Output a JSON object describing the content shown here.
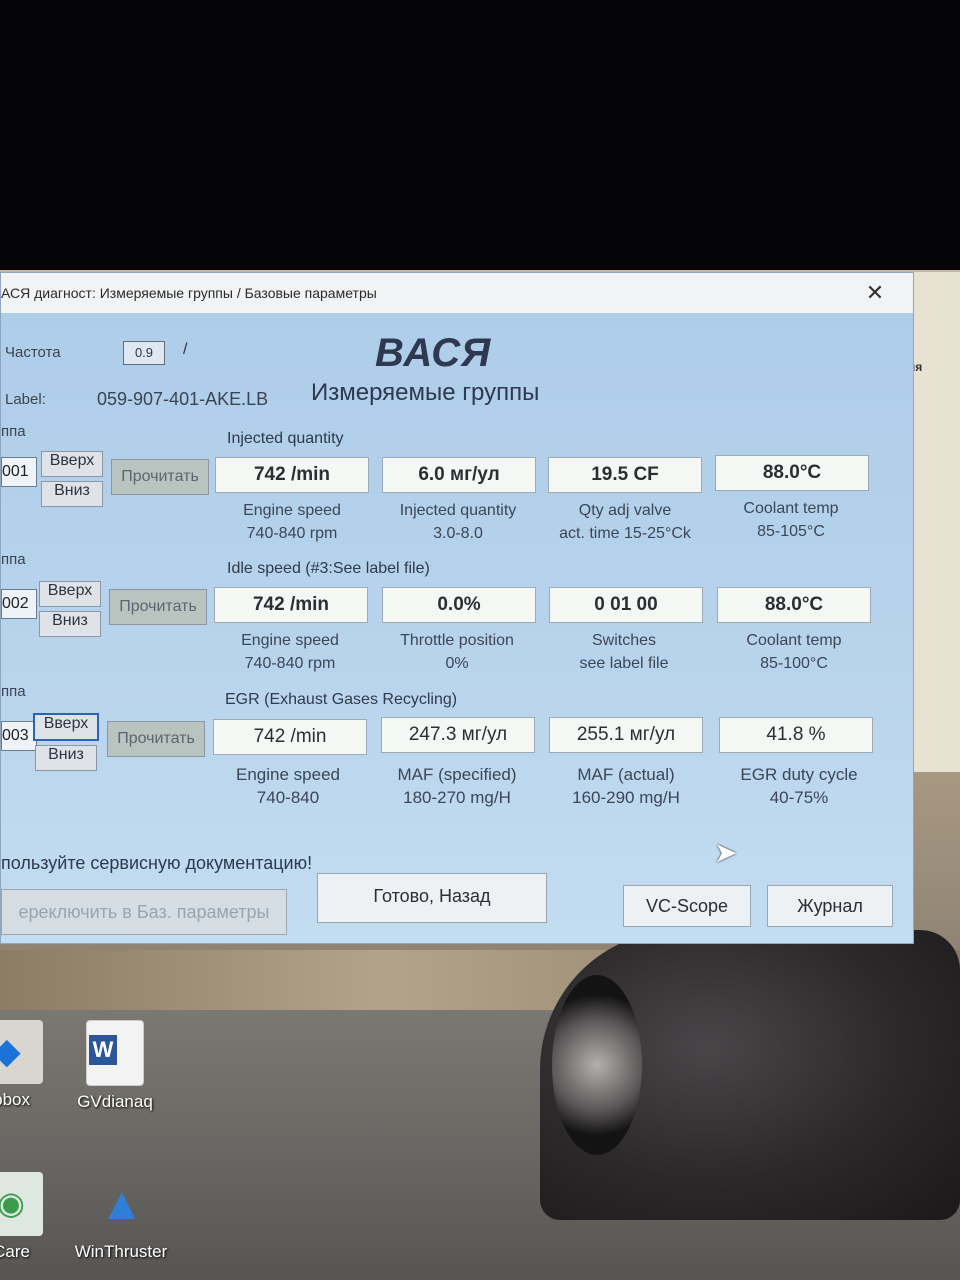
{
  "window": {
    "title": "АСЯ диагност: Измеряемые группы / Базовые параметры",
    "close_glyph": "✕"
  },
  "header": {
    "freq_label": "Частота",
    "freq_value": "0.9",
    "freq_spin": "/",
    "label_label": "Label:",
    "label_file": "059-907-401-AKE.LB",
    "logo": "ВАСЯ",
    "subtitle": "Измеряемые группы"
  },
  "groups": [
    {
      "group_label": "ппа",
      "number": "001",
      "title": "Injected quantity",
      "up_label": "Вверх",
      "down_label": "Вниз",
      "read_label": "Прочитать",
      "fields": [
        {
          "value": "742 /min",
          "name": "Engine speed",
          "range": "740-840 rpm"
        },
        {
          "value": "6.0 мг/ул",
          "name": "Injected quantity",
          "range": "3.0-8.0"
        },
        {
          "value": "19.5 CF",
          "name": "Qty adj valve",
          "range": "act. time 15-25°Ck"
        },
        {
          "value": "88.0°C",
          "name": "Coolant temp",
          "range": "85-105°C"
        }
      ]
    },
    {
      "group_label": "ппа",
      "number": "002",
      "title": "Idle speed (#3:See label file)",
      "up_label": "Вверх",
      "down_label": "Вниз",
      "read_label": "Прочитать",
      "fields": [
        {
          "value": "742 /min",
          "name": "Engine speed",
          "range": "740-840 rpm"
        },
        {
          "value": "0.0%",
          "name": "Throttle position",
          "range": "0%"
        },
        {
          "value": "0 01 00",
          "name": "Switches",
          "range": "see label file"
        },
        {
          "value": "88.0°C",
          "name": "Coolant temp",
          "range": "85-100°C"
        }
      ]
    },
    {
      "group_label": "ппа",
      "number": "003",
      "title": "EGR (Exhaust Gases Recycling)",
      "up_label": "Вверх",
      "down_label": "Вниз",
      "read_label": "Прочитать",
      "fields": [
        {
          "value": "742 /min",
          "name": "Engine speed",
          "range": "740-840"
        },
        {
          "value": "247.3 мг/ул",
          "name": "MAF (specified)",
          "range": "180-270 mg/H"
        },
        {
          "value": "255.1 мг/ул",
          "name": "MAF (actual)",
          "range": "160-290 mg/H"
        },
        {
          "value": "41.8 %",
          "name": "EGR duty cycle",
          "range": "40-75%"
        }
      ]
    }
  ],
  "footer": {
    "warning": "пользуйте сервисную документацию!",
    "switch_basic": "ереключить в Баз. параметры",
    "done_back": "Готово, Назад",
    "vc_scope": "VC-Scope",
    "journal": "Журнал"
  },
  "desktop": {
    "right_strip_text": "ня",
    "icons": [
      {
        "label": "pbox",
        "icon": "dropbox-icon"
      },
      {
        "label": "GVdianaq",
        "icon": "word-document-icon"
      },
      {
        "label": "Care",
        "icon": "care-icon"
      },
      {
        "label": "WinThruster",
        "icon": "winthruster-icon"
      }
    ]
  }
}
